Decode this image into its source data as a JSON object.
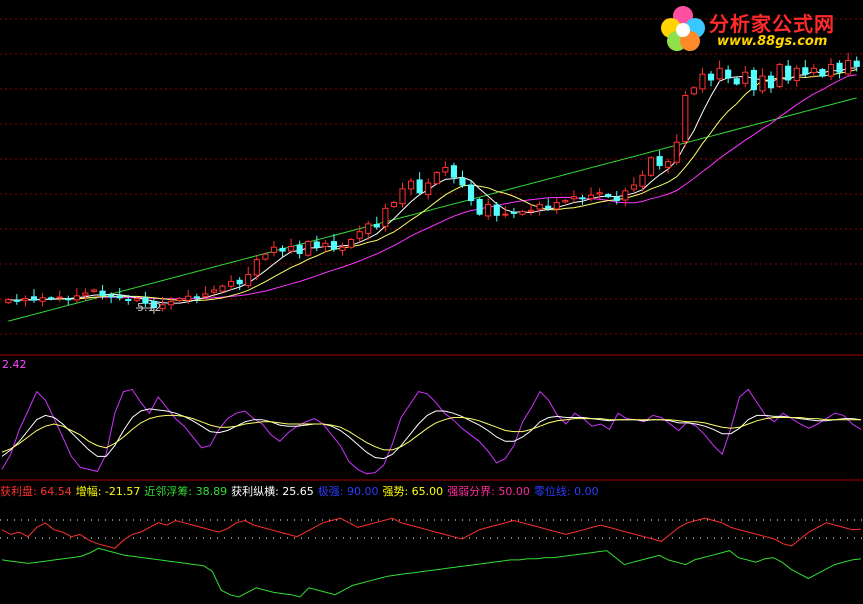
{
  "logo": {
    "title": "分析家公式网",
    "url": "www.88gs.com"
  },
  "price_panel": {
    "low_marker": "5.12"
  },
  "osc_panel": {
    "value_label": "2.42"
  },
  "indicator_legend": [
    {
      "label": "获利盘",
      "value": "64.54",
      "color": "#ff3030"
    },
    {
      "label": "增幅",
      "value": "-21.57",
      "color": "#ffff00"
    },
    {
      "label": "近邻浮筹",
      "value": "38.89",
      "color": "#33dd33"
    },
    {
      "label": "获利纵横",
      "value": "25.65",
      "color": "#ffffff"
    },
    {
      "label": "极强",
      "value": "90.00",
      "color": "#2a3cff"
    },
    {
      "label": "强势",
      "value": "65.00",
      "color": "#ffff00"
    },
    {
      "label": "强弱分界",
      "value": "50.00",
      "color": "#ff2a9a"
    },
    {
      "label": "零位线",
      "value": "0.00",
      "color": "#2a3cff"
    }
  ],
  "colors": {
    "up_candle": "#ff3030",
    "down_candle": "#54ffff",
    "ma_short": "#ffffff",
    "ma_mid": "#ffff66",
    "ma_long": "#ff33ff",
    "ma_very_long": "#33dd33",
    "grid": "#8a0000",
    "separator": "#aa0000"
  },
  "chart_data": [
    {
      "type": "candlestick",
      "title": "",
      "annotations": [
        "5.12"
      ],
      "close": [
        5.55,
        5.52,
        5.58,
        5.54,
        5.6,
        5.57,
        5.62,
        5.56,
        5.65,
        5.72,
        5.8,
        5.66,
        5.62,
        5.6,
        5.55,
        5.58,
        5.46,
        5.35,
        5.42,
        5.5,
        5.58,
        5.64,
        5.62,
        5.7,
        5.8,
        5.9,
        6.02,
        5.96,
        6.2,
        6.58,
        6.72,
        6.9,
        6.8,
        6.92,
        6.74,
        7.05,
        6.9,
        7.0,
        6.85,
        6.9,
        7.1,
        7.3,
        7.5,
        7.42,
        7.9,
        8.05,
        8.4,
        8.6,
        8.3,
        8.55,
        8.82,
        8.95,
        8.7,
        8.5,
        8.1,
        7.75,
        8.0,
        7.72,
        7.75,
        7.78,
        7.82,
        7.85,
        8.0,
        7.9,
        8.05,
        8.1,
        8.2,
        8.15,
        8.24,
        8.3,
        8.2,
        8.1,
        8.35,
        8.5,
        8.75,
        9.2,
        9.0,
        9.1,
        9.6,
        10.8,
        11.0,
        11.35,
        11.2,
        11.5,
        11.25,
        11.1,
        11.4,
        10.95,
        11.3,
        11.0,
        11.6,
        11.2,
        11.5,
        11.35,
        11.5,
        11.3,
        11.6,
        11.4,
        11.7,
        11.55
      ],
      "ma": [
        {
          "name": "MA5",
          "color": "#ffffff"
        },
        {
          "name": "MA10",
          "color": "#ffff66"
        },
        {
          "name": "MA20",
          "color": "#ff33ff"
        },
        {
          "name": "MA60",
          "color": "#33dd33"
        }
      ]
    },
    {
      "type": "line",
      "title": "",
      "value_label": "2.42",
      "series": [
        {
          "name": "",
          "color": "#cc33ff",
          "values": [
            8,
            22,
            45,
            62,
            80,
            72,
            55,
            38,
            20,
            10,
            8,
            6,
            22,
            60,
            80,
            82,
            70,
            60,
            75,
            65,
            55,
            48,
            38,
            28,
            30,
            45,
            55,
            60,
            62,
            55,
            50,
            40,
            34,
            42,
            48,
            52,
            55,
            50,
            40,
            30,
            15,
            8,
            4,
            5,
            12,
            32,
            56,
            68,
            80,
            78,
            70,
            60,
            54,
            46,
            40,
            34,
            25,
            14,
            18,
            30,
            52,
            65,
            80,
            72,
            58,
            50,
            60,
            55,
            48,
            50,
            45,
            60,
            55,
            54,
            52,
            58,
            56,
            50,
            44,
            52,
            48,
            40,
            30,
            22,
            46,
            75,
            82,
            70,
            58,
            52,
            60,
            55,
            50,
            46,
            50,
            55,
            60,
            58,
            50,
            45
          ]
        },
        {
          "name": "",
          "color": "#ffffff",
          "values": [
            20,
            26,
            34,
            44,
            54,
            58,
            56,
            50,
            42,
            34,
            26,
            20,
            20,
            30,
            44,
            56,
            62,
            64,
            63,
            62,
            60,
            57,
            53,
            48,
            43,
            42,
            44,
            48,
            52,
            54,
            54,
            52,
            49,
            48,
            48,
            49,
            50,
            50,
            48,
            44,
            38,
            31,
            24,
            19,
            18,
            22,
            30,
            40,
            50,
            58,
            62,
            62,
            60,
            57,
            53,
            49,
            44,
            38,
            34,
            34,
            38,
            44,
            52,
            56,
            57,
            56,
            56,
            56,
            55,
            54,
            53,
            54,
            54,
            54,
            53,
            54,
            54,
            53,
            51,
            51,
            50,
            48,
            45,
            41,
            41,
            46,
            54,
            58,
            58,
            57,
            57,
            56,
            55,
            54,
            53,
            53,
            54,
            55,
            55,
            54
          ]
        },
        {
          "name": "",
          "color": "#ffff66",
          "values": [
            24,
            27,
            32,
            38,
            44,
            48,
            50,
            48,
            44,
            40,
            34,
            30,
            28,
            32,
            38,
            45,
            51,
            55,
            57,
            58,
            58,
            57,
            55,
            52,
            49,
            47,
            47,
            48,
            50,
            51,
            52,
            52,
            51,
            50,
            50,
            50,
            50,
            50,
            49,
            47,
            43,
            38,
            33,
            29,
            26,
            26,
            29,
            34,
            40,
            46,
            51,
            54,
            56,
            56,
            55,
            53,
            50,
            47,
            44,
            43,
            43,
            45,
            48,
            51,
            53,
            54,
            55,
            55,
            55,
            55,
            54,
            54,
            54,
            54,
            54,
            54,
            54,
            54,
            53,
            52,
            52,
            51,
            49,
            47,
            46,
            47,
            50,
            53,
            55,
            56,
            56,
            56,
            56,
            55,
            55,
            54,
            54,
            54,
            54,
            54
          ]
        }
      ]
    },
    {
      "type": "line",
      "title": "",
      "series": [
        {
          "name": "获利盘",
          "color": "#ff3030",
          "values": [
            64,
            60,
            62,
            58,
            66,
            70,
            64,
            62,
            58,
            60,
            55,
            52,
            50,
            48,
            55,
            60,
            62,
            66,
            70,
            68,
            72,
            70,
            68,
            66,
            64,
            62,
            65,
            70,
            72,
            68,
            66,
            64,
            62,
            60,
            58,
            62,
            66,
            70,
            72,
            74,
            70,
            66,
            68,
            70,
            72,
            74,
            70,
            68,
            66,
            64,
            62,
            60,
            58,
            56,
            60,
            64,
            66,
            68,
            70,
            72,
            70,
            68,
            66,
            64,
            62,
            60,
            62,
            64,
            66,
            68,
            66,
            64,
            62,
            60,
            58,
            56,
            54,
            60,
            66,
            70,
            72,
            74,
            72,
            70,
            66,
            64,
            62,
            60,
            58,
            56,
            52,
            50,
            56,
            62,
            66,
            70,
            68,
            66,
            64,
            64.54
          ]
        },
        {
          "name": "近邻浮筹",
          "color": "#33dd33",
          "values": [
            38,
            37,
            36,
            35,
            36,
            37,
            38,
            39,
            40,
            41,
            44,
            48,
            46,
            44,
            42,
            41,
            40,
            39,
            38,
            37,
            36,
            35,
            34,
            33,
            28,
            12,
            8,
            6,
            10,
            14,
            12,
            10,
            9,
            8,
            6,
            14,
            12,
            10,
            8,
            12,
            16,
            18,
            20,
            22,
            24,
            25,
            26,
            27,
            28,
            29,
            30,
            31,
            32,
            33,
            34,
            35,
            36,
            37,
            38,
            38,
            39,
            39,
            40,
            40,
            41,
            42,
            43,
            44,
            45,
            46,
            40,
            34,
            36,
            38,
            40,
            42,
            38,
            36,
            34,
            38,
            40,
            42,
            44,
            46,
            40,
            38,
            36,
            38.89,
            40,
            36,
            30,
            26,
            22,
            26,
            30,
            34,
            36,
            38,
            38.89
          ]
        }
      ]
    }
  ]
}
